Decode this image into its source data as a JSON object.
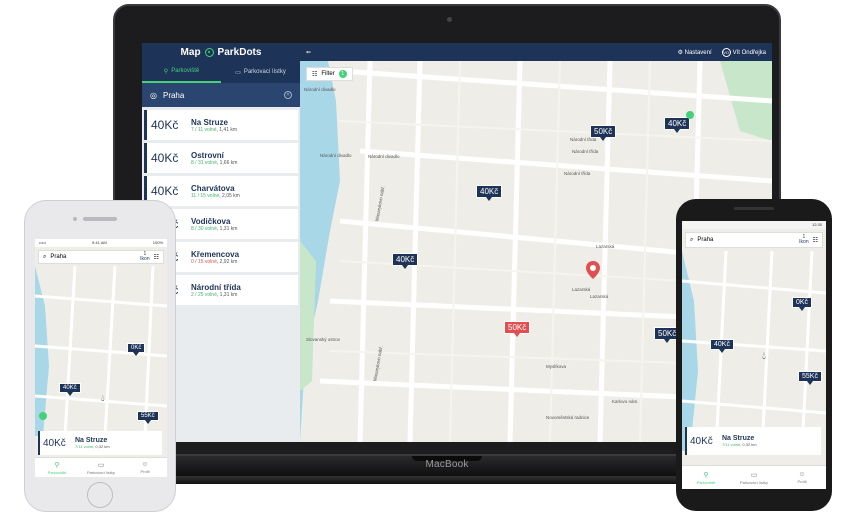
{
  "colors": {
    "brand": "#1d3357",
    "accent": "#44d17a",
    "alert": "#e05050"
  },
  "laptop": {
    "device_label": "MacBook",
    "app": {
      "brand_left": "Map",
      "brand_right": "ParkDots",
      "tabs": [
        {
          "label": "Parkoviště",
          "icon": "pin-icon"
        },
        {
          "label": "Parkovací lístky",
          "icon": "ticket-icon"
        }
      ],
      "city": "Praha",
      "lots": [
        {
          "price": "40Kč",
          "name": "Na Struze",
          "free": "7 / 11 volné",
          "dist": ", 1,41 km"
        },
        {
          "price": "40Kč",
          "name": "Ostrovní",
          "free": "8 / 31 volné",
          "dist": ", 1,66 km"
        },
        {
          "price": "40Kč",
          "name": "Charvátova",
          "free": "11 / 15 volné",
          "dist": ", 2,05 km"
        },
        {
          "price": "40Kč",
          "name": "Vodičkova",
          "free": "8 / 30 volné",
          "dist": ", 1,31 km"
        },
        {
          "price": "40Kč",
          "name": "Křemencova",
          "free": "0 / 15 volné",
          "dist": ", 2,92 km"
        },
        {
          "price": "40Kč",
          "name": "Národní třída",
          "free": "2 / 25 volné",
          "dist": ", 1,31 km"
        }
      ],
      "topbar": {
        "settings": "Nastavení",
        "user_initials": "VO",
        "user": "Vít Ondřejka"
      },
      "filter": {
        "label": "Filter",
        "count": "1"
      },
      "markers": [
        "50Kč",
        "40Kč",
        "40Kč",
        "40Kč",
        "50Kč",
        "50Kč"
      ],
      "pois": [
        "Národní divadlo",
        "Národní divadlo",
        "Národní divadlo",
        "Národní třída",
        "Národní třída",
        "Národní třída",
        "Lazarská",
        "Lazarská",
        "Lazarská",
        "Myslíkova",
        "Novoměstská radnice",
        "Masarykovo nábř.",
        "Masarykovo nábř.",
        "Slovanský ostrov",
        "Karlovo nám."
      ]
    }
  },
  "iphone": {
    "status": {
      "left": "••••• ",
      "time": "9:41 AM",
      "right": "100%"
    },
    "search": "Praha",
    "chip": {
      "count": "1",
      "label": "Ikon"
    },
    "markers": [
      "0Kč",
      "40Kč",
      "55Kč"
    ],
    "card": {
      "price": "40Kč",
      "name": "Na Struze",
      "free": "7/11 volné",
      "dist": ", 0,32 km"
    },
    "nav": [
      {
        "label": "Parkoviště",
        "icon": "pin-icon"
      },
      {
        "label": "Parkovací lístky",
        "icon": "ticket-icon"
      },
      {
        "label": "Profil",
        "icon": "user-icon"
      }
    ]
  },
  "android": {
    "status": {
      "time": "12:30"
    },
    "search": "Praha",
    "chip": {
      "count": "1",
      "label": "Ikon"
    },
    "markers": [
      "0Kč",
      "40Kč",
      "55Kč"
    ],
    "card": {
      "price": "40Kč",
      "name": "Na Struze",
      "free": "7/11 volné",
      "dist": ", 0,32 km"
    },
    "nav": [
      {
        "label": "Parkoviště",
        "icon": "pin-icon"
      },
      {
        "label": "Parkovací lístky",
        "icon": "ticket-icon"
      },
      {
        "label": "Profil",
        "icon": "user-icon"
      }
    ]
  }
}
